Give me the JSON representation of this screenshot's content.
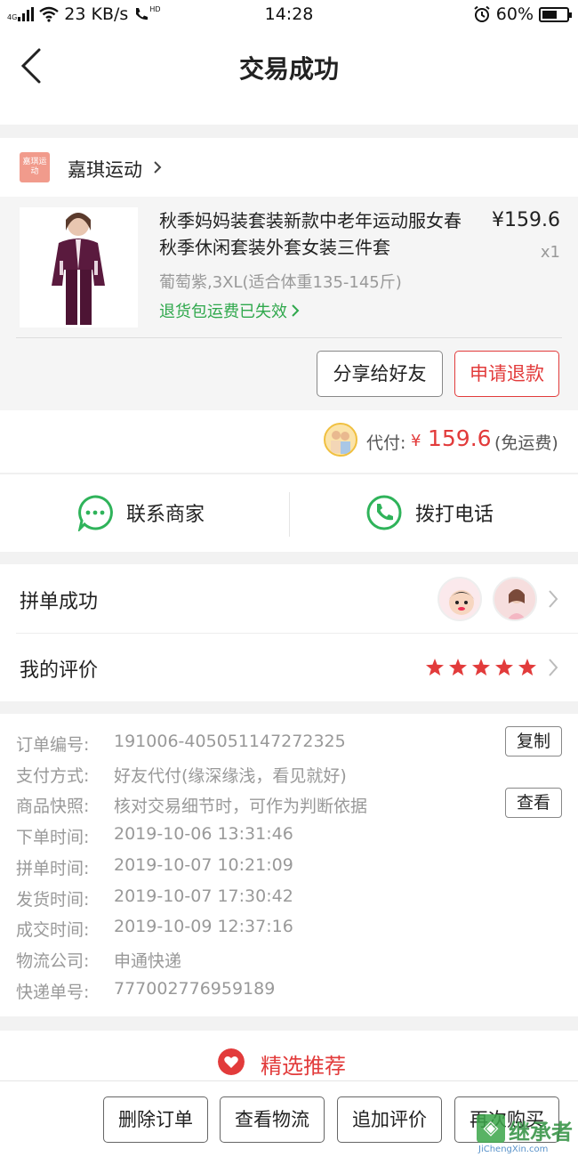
{
  "status_bar": {
    "network": "4G",
    "speed": "23 KB/s",
    "call_badge": "HD",
    "time": "14:28",
    "battery": "60%",
    "battery_level": 0.6
  },
  "nav": {
    "title": "交易成功"
  },
  "store": {
    "logo_text": "嘉琪运动",
    "name": "嘉琪运动"
  },
  "product": {
    "title": "秋季妈妈装套装新款中老年运动服女春秋季休闲套装外套女装三件套",
    "price": "¥159.6",
    "qty": "x1",
    "spec": "葡萄紫,3XL(适合体重135-145斤)",
    "return_note": "退货包运费已失效",
    "share_label": "分享给好友",
    "refund_label": "申请退款"
  },
  "payment": {
    "label": "代付:",
    "yen": "¥",
    "amount": "159.6",
    "shipping": "(免运费)"
  },
  "contact": {
    "merchant": "联系商家",
    "call": "拨打电话"
  },
  "group": {
    "label": "拼单成功"
  },
  "review": {
    "label": "我的评价",
    "stars": 5
  },
  "order_info": {
    "rows": [
      {
        "key": "订单编号:",
        "value": "191006-405051147272325"
      },
      {
        "key": "支付方式:",
        "value": "好友代付(缘深缘浅，看见就好)"
      },
      {
        "key": "商品快照:",
        "value": "核对交易细节时，可作为判断依据"
      },
      {
        "key": "下单时间:",
        "value": "2019-10-06 13:31:46"
      },
      {
        "key": "拼单时间:",
        "value": "2019-10-07 10:21:09"
      },
      {
        "key": "发货时间:",
        "value": "2019-10-07 17:30:42"
      },
      {
        "key": "成交时间:",
        "value": "2019-10-09 12:37:16"
      },
      {
        "key": "物流公司:",
        "value": "申通快递"
      },
      {
        "key": "快递单号:",
        "value": "777002776959189"
      }
    ],
    "copy_label": "复制",
    "view_label": "查看"
  },
  "recommend": {
    "title": "精选推荐"
  },
  "bottom_actions": {
    "delete": "删除订单",
    "logistics": "查看物流",
    "add_review": "追加评价",
    "rebuy": "再次购买"
  },
  "watermark": {
    "text": "继承者",
    "sub": "JiChengXin.com"
  },
  "colors": {
    "accent_red": "#e23b3b",
    "accent_green": "#2fa84c",
    "wechat_green": "#2fb35a"
  }
}
